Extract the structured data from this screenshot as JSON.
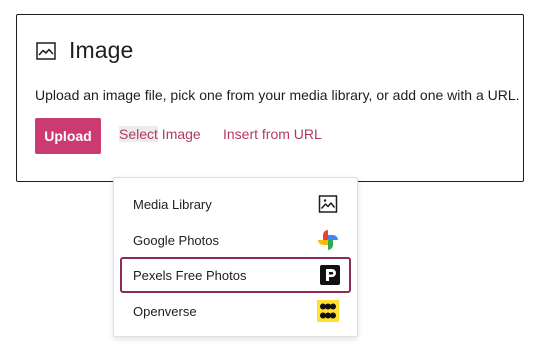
{
  "placeholder": {
    "title": "Image",
    "instructions": "Upload an image file, pick one from your media library, or add one with a URL.",
    "upload_label": "Upload",
    "select_label_part1": "Select",
    "select_label_part2": " Image",
    "insert_url_label": "Insert from URL"
  },
  "dropdown": {
    "items": [
      {
        "label": "Media Library",
        "icon": "media-library-icon"
      },
      {
        "label": "Google Photos",
        "icon": "google-photos-icon"
      },
      {
        "label": "Pexels Free Photos",
        "icon": "pexels-icon"
      },
      {
        "label": "Openverse",
        "icon": "openverse-icon"
      }
    ],
    "active_item": "Pexels Free Photos"
  },
  "colors": {
    "accent": "#cc3a72",
    "link": "#b33a63",
    "active_border": "#8c2a5a",
    "openverse_yellow": "#ffe033"
  }
}
